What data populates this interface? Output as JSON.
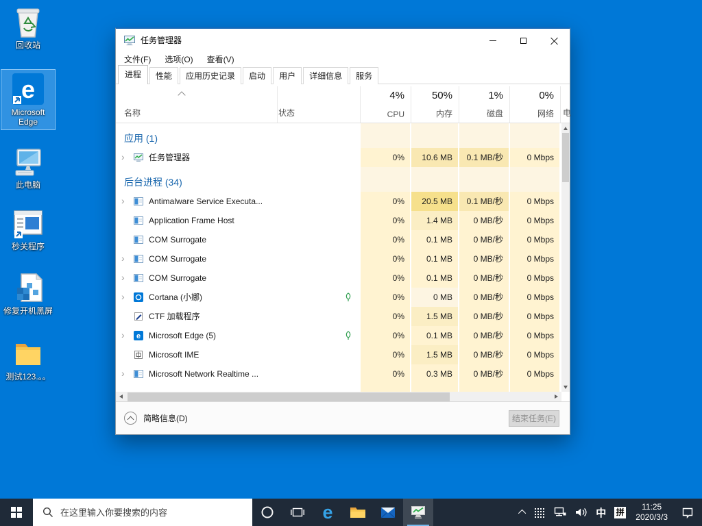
{
  "desktop": {
    "icons": [
      {
        "label": "回收站",
        "name": "recycle-bin"
      },
      {
        "label": "Microsoft Edge",
        "name": "edge-shortcut",
        "selected": true
      },
      {
        "label": "此电脑",
        "name": "this-pc"
      },
      {
        "label": "秒关程序",
        "name": "quick-close-app"
      },
      {
        "label": "修复开机黑屏",
        "name": "registry-fix-file"
      },
      {
        "label": "测试123.。。",
        "name": "test-folder"
      }
    ]
  },
  "taskmgr": {
    "title": "任务管理器",
    "menu": [
      "文件(F)",
      "选项(O)",
      "查看(V)"
    ],
    "tabs": [
      "进程",
      "性能",
      "应用历史记录",
      "启动",
      "用户",
      "详细信息",
      "服务"
    ],
    "active_tab": "进程",
    "columns": {
      "name": "名称",
      "status": "状态",
      "power_partial": "电",
      "usage": [
        {
          "pct": "4%",
          "label": "CPU"
        },
        {
          "pct": "50%",
          "label": "内存"
        },
        {
          "pct": "1%",
          "label": "磁盘"
        },
        {
          "pct": "0%",
          "label": "网络"
        }
      ]
    },
    "rows": [
      {
        "kind": "section",
        "label": "应用 (1)"
      },
      {
        "kind": "process",
        "name": "任务管理器",
        "icon": "taskmgr",
        "expand": true,
        "leaf": false,
        "cpu": "0%",
        "mem": "10.6 MB",
        "disk": "0.1 MB/秒",
        "net": "0 Mbps",
        "heat": {
          "cpu": "low",
          "mem": "mid",
          "disk": "mid",
          "net": "low"
        }
      },
      {
        "kind": "spacer"
      },
      {
        "kind": "section",
        "label": "后台进程 (34)"
      },
      {
        "kind": "process",
        "name": "Antimalware Service Executa...",
        "icon": "generic",
        "expand": true,
        "leaf": false,
        "cpu": "0%",
        "mem": "20.5 MB",
        "disk": "0.1 MB/秒",
        "net": "0 Mbps",
        "heat": {
          "cpu": "low",
          "mem": "high",
          "disk": "mid",
          "net": "low"
        }
      },
      {
        "kind": "process",
        "name": "Application Frame Host",
        "icon": "generic",
        "expand": false,
        "leaf": false,
        "cpu": "0%",
        "mem": "1.4 MB",
        "disk": "0 MB/秒",
        "net": "0 Mbps",
        "heat": {
          "cpu": "low",
          "mem": "midlow",
          "disk": "low",
          "net": "low"
        }
      },
      {
        "kind": "process",
        "name": "COM Surrogate",
        "icon": "generic",
        "expand": false,
        "leaf": false,
        "cpu": "0%",
        "mem": "0.1 MB",
        "disk": "0 MB/秒",
        "net": "0 Mbps",
        "heat": {
          "cpu": "low",
          "mem": "low",
          "disk": "low",
          "net": "low"
        }
      },
      {
        "kind": "process",
        "name": "COM Surrogate",
        "icon": "generic",
        "expand": true,
        "leaf": false,
        "cpu": "0%",
        "mem": "0.1 MB",
        "disk": "0 MB/秒",
        "net": "0 Mbps",
        "heat": {
          "cpu": "low",
          "mem": "low",
          "disk": "low",
          "net": "low"
        }
      },
      {
        "kind": "process",
        "name": "COM Surrogate",
        "icon": "generic",
        "expand": true,
        "leaf": false,
        "cpu": "0%",
        "mem": "0.1 MB",
        "disk": "0 MB/秒",
        "net": "0 Mbps",
        "heat": {
          "cpu": "low",
          "mem": "low",
          "disk": "low",
          "net": "low"
        }
      },
      {
        "kind": "process",
        "name": "Cortana (小娜)",
        "icon": "cortana",
        "expand": true,
        "leaf": true,
        "cpu": "0%",
        "mem": "0 MB",
        "disk": "0 MB/秒",
        "net": "0 Mbps",
        "heat": {
          "cpu": "low",
          "mem": "base",
          "disk": "low",
          "net": "low"
        }
      },
      {
        "kind": "process",
        "name": "CTF 加载程序",
        "icon": "ctf",
        "expand": false,
        "leaf": false,
        "cpu": "0%",
        "mem": "1.5 MB",
        "disk": "0 MB/秒",
        "net": "0 Mbps",
        "heat": {
          "cpu": "low",
          "mem": "midlow",
          "disk": "low",
          "net": "low"
        }
      },
      {
        "kind": "process",
        "name": "Microsoft Edge (5)",
        "icon": "edge",
        "expand": true,
        "leaf": true,
        "cpu": "0%",
        "mem": "0.1 MB",
        "disk": "0 MB/秒",
        "net": "0 Mbps",
        "heat": {
          "cpu": "low",
          "mem": "low",
          "disk": "low",
          "net": "low"
        }
      },
      {
        "kind": "process",
        "name": "Microsoft IME",
        "icon": "ime",
        "expand": false,
        "leaf": false,
        "cpu": "0%",
        "mem": "1.5 MB",
        "disk": "0 MB/秒",
        "net": "0 Mbps",
        "heat": {
          "cpu": "low",
          "mem": "midlow",
          "disk": "low",
          "net": "low"
        }
      },
      {
        "kind": "process",
        "name": "Microsoft Network Realtime ...",
        "icon": "generic",
        "expand": true,
        "leaf": false,
        "cpu": "0%",
        "mem": "0.3 MB",
        "disk": "0 MB/秒",
        "net": "0 Mbps",
        "heat": {
          "cpu": "low",
          "mem": "low",
          "disk": "low",
          "net": "low"
        }
      },
      {
        "kind": "partial"
      }
    ],
    "footer": {
      "details_toggle": "简略信息(D)",
      "end_task_button": "结束任务(E)"
    }
  },
  "taskbar": {
    "search_placeholder": "在这里输入你要搜索的内容",
    "ime_mode": "中",
    "ime_pinyin": "拼",
    "clock": {
      "time": "11:25",
      "date": "2020/3/3"
    }
  }
}
